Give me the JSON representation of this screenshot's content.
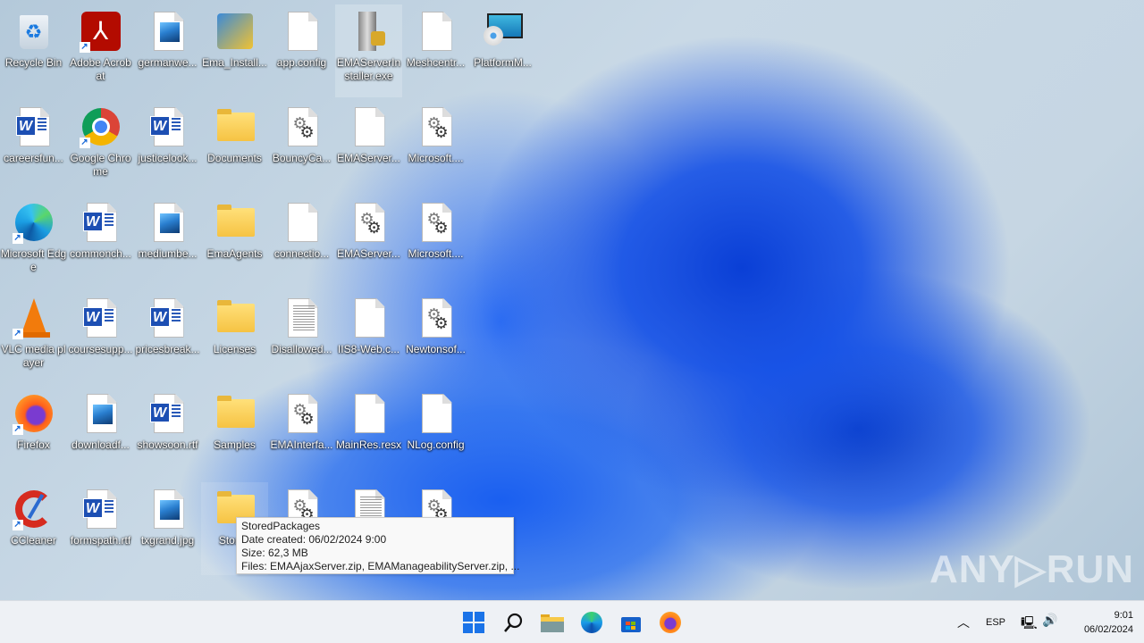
{
  "desktop": {
    "icons": [
      {
        "label": "Recycle Bin",
        "type": "recycle",
        "col": 0,
        "row": 0
      },
      {
        "label": "Adobe Acrobat",
        "type": "acrobat",
        "col": 1,
        "row": 0,
        "shortcut": true
      },
      {
        "label": "germanwe...",
        "type": "image",
        "col": 2,
        "row": 0
      },
      {
        "label": "Ema_Install...",
        "type": "installer",
        "col": 3,
        "row": 0
      },
      {
        "label": "app.config",
        "type": "blank",
        "col": 4,
        "row": 0
      },
      {
        "label": "EMAServerInstaller.exe",
        "type": "server",
        "col": 5,
        "row": 0,
        "selected": true
      },
      {
        "label": "Meshcentr...",
        "type": "blank",
        "col": 6,
        "row": 0
      },
      {
        "label": "PlatformM...",
        "type": "platform",
        "col": 7,
        "row": 0
      },
      {
        "label": "careersfun...",
        "type": "word",
        "col": 0,
        "row": 1
      },
      {
        "label": "Google Chrome",
        "type": "chrome",
        "col": 1,
        "row": 1,
        "shortcut": true
      },
      {
        "label": "justicelook...",
        "type": "word",
        "col": 2,
        "row": 1
      },
      {
        "label": "Documents",
        "type": "folder",
        "col": 3,
        "row": 1
      },
      {
        "label": "BouncyCa...",
        "type": "gear",
        "col": 4,
        "row": 1
      },
      {
        "label": "EMAServer...",
        "type": "blank",
        "col": 5,
        "row": 1
      },
      {
        "label": "Microsoft....",
        "type": "gear",
        "col": 6,
        "row": 1
      },
      {
        "label": "Microsoft Edge",
        "type": "edge",
        "col": 0,
        "row": 2,
        "shortcut": true
      },
      {
        "label": "commonch...",
        "type": "word",
        "col": 1,
        "row": 2
      },
      {
        "label": "mediumbe...",
        "type": "image",
        "col": 2,
        "row": 2
      },
      {
        "label": "EmaAgents",
        "type": "folder",
        "col": 3,
        "row": 2
      },
      {
        "label": "connectio...",
        "type": "blank",
        "col": 4,
        "row": 2
      },
      {
        "label": "EMAServer...",
        "type": "gear",
        "col": 5,
        "row": 2
      },
      {
        "label": "Microsoft....",
        "type": "gear",
        "col": 6,
        "row": 2
      },
      {
        "label": "VLC media player",
        "type": "vlc",
        "col": 0,
        "row": 3,
        "shortcut": true
      },
      {
        "label": "coursesupp...",
        "type": "word",
        "col": 1,
        "row": 3
      },
      {
        "label": "pricesbreak...",
        "type": "word",
        "col": 2,
        "row": 3
      },
      {
        "label": "Licenses",
        "type": "folder",
        "col": 3,
        "row": 3
      },
      {
        "label": "Disallowed...",
        "type": "text",
        "col": 4,
        "row": 3
      },
      {
        "label": "IIS8-Web.c...",
        "type": "blank",
        "col": 5,
        "row": 3
      },
      {
        "label": "Newtonsof...",
        "type": "gear",
        "col": 6,
        "row": 3
      },
      {
        "label": "Firefox",
        "type": "firefox",
        "col": 0,
        "row": 4,
        "shortcut": true
      },
      {
        "label": "downloadf...",
        "type": "image",
        "col": 1,
        "row": 4
      },
      {
        "label": "showsoon.rtf",
        "type": "word",
        "col": 2,
        "row": 4
      },
      {
        "label": "Samples",
        "type": "folder",
        "col": 3,
        "row": 4
      },
      {
        "label": "EMAInterfa...",
        "type": "gear",
        "col": 4,
        "row": 4
      },
      {
        "label": "MainRes.resx",
        "type": "blank",
        "col": 5,
        "row": 4
      },
      {
        "label": "NLog.config",
        "type": "blank",
        "col": 6,
        "row": 4
      },
      {
        "label": "CCleaner",
        "type": "ccleaner",
        "col": 0,
        "row": 5,
        "shortcut": true
      },
      {
        "label": "formspath.rtf",
        "type": "word",
        "col": 1,
        "row": 5
      },
      {
        "label": "txgrand.jpg",
        "type": "image",
        "col": 2,
        "row": 5
      },
      {
        "label": "Stored",
        "type": "folder",
        "col": 3,
        "row": 5,
        "hover": true
      },
      {
        "label": "",
        "type": "gear",
        "col": 4,
        "row": 5
      },
      {
        "label": "",
        "type": "text",
        "col": 5,
        "row": 5
      },
      {
        "label": "",
        "type": "gear",
        "col": 6,
        "row": 5
      }
    ]
  },
  "tooltip": {
    "name": "StoredPackages",
    "date": "Date created: 06/02/2024 9:00",
    "size": "Size: 62,3 MB",
    "files": "Files: EMAAjaxServer.zip, EMAManageabilityServer.zip, ..."
  },
  "taskbar": {
    "apps": [
      "start",
      "search",
      "file-explorer",
      "edge",
      "store",
      "firefox"
    ],
    "language": "ESP",
    "time": "9:01",
    "date": "06/02/2024"
  },
  "watermark": "ANY RUN"
}
